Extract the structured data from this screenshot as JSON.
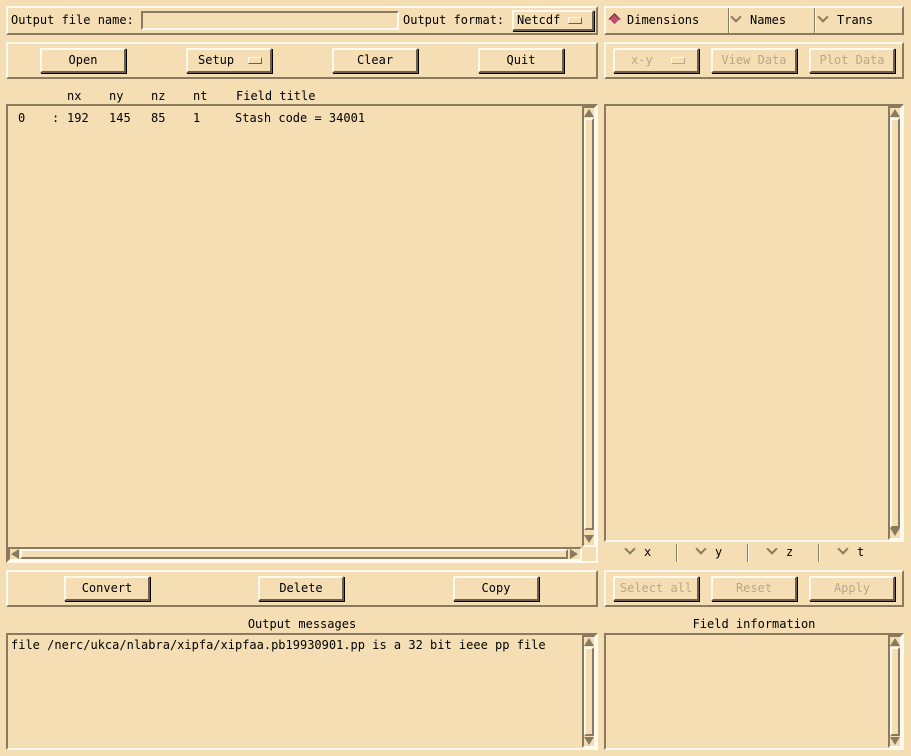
{
  "top_bar": {
    "output_file_label": "Output file name:",
    "output_file_value": "",
    "output_format_label": "Output format:",
    "output_format_value": "Netcdf"
  },
  "view_mode": {
    "options": [
      {
        "label": "Dimensions",
        "selected": true
      },
      {
        "label": "Names",
        "selected": false
      },
      {
        "label": "Trans",
        "selected": false
      }
    ]
  },
  "main_toolbar": {
    "open": "Open",
    "setup": "Setup",
    "clear": "Clear",
    "quit": "Quit"
  },
  "plot_toolbar": {
    "axes_select": "x-y",
    "view_data": "View Data",
    "plot_data": "Plot Data"
  },
  "field_list": {
    "headers": {
      "nx": "nx",
      "ny": "ny",
      "nz": "nz",
      "nt": "nt",
      "title": "Field title"
    },
    "rows": [
      {
        "index": "0",
        "sep": ":",
        "nx": "192",
        "ny": "145",
        "nz": "85",
        "nt": "1",
        "title": "Stash code = 34001"
      }
    ]
  },
  "dims": {
    "x": "x",
    "y": "y",
    "z": "z",
    "t": "t"
  },
  "actions": {
    "convert": "Convert",
    "delete": "Delete",
    "copy": "Copy"
  },
  "select_actions": {
    "select_all": "Select all",
    "reset": "Reset",
    "apply": "Apply"
  },
  "output_messages": {
    "heading": "Output messages",
    "lines": [
      "file /nerc/ukca/nlabra/xipfa/xipfaa.pb19930901.pp is a 32 bit ieee pp file"
    ]
  },
  "field_information": {
    "heading": "Field information"
  },
  "colors": {
    "background": "#f5deb3",
    "selected_radio": "#c0506a",
    "disabled_text": "#b8a78a"
  }
}
